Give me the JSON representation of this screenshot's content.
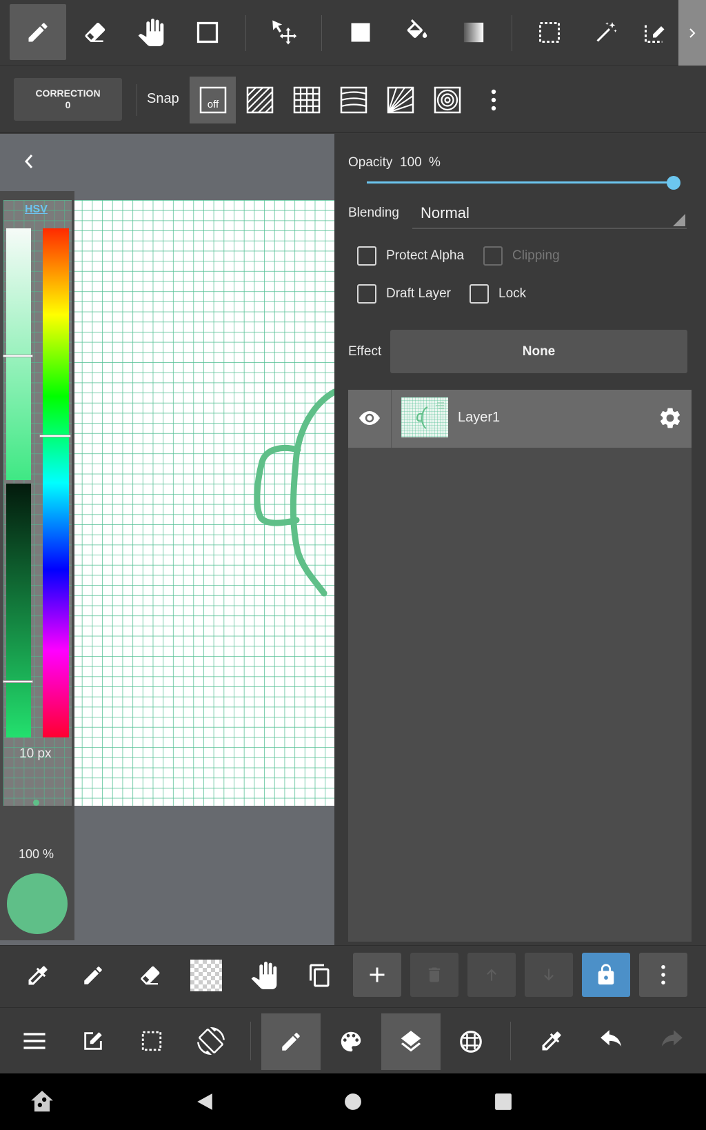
{
  "toolbar": {
    "tools": [
      "pen",
      "eraser",
      "hand",
      "rectangle",
      "move",
      "fill-square",
      "bucket",
      "gradient",
      "select-rect",
      "magic-wand",
      "select-pen"
    ],
    "selected_tool": "pen"
  },
  "sub_toolbar": {
    "correction_label": "CORRECTION",
    "correction_value": "0",
    "snap_label": "Snap",
    "snap_off_label": "off"
  },
  "color_panel": {
    "mode_label": "HSV",
    "brush_size": "10 px",
    "opacity": "100 %",
    "current_color": "#5fbf88"
  },
  "layer_panel": {
    "opacity_label": "Opacity",
    "opacity_value": "100",
    "opacity_unit": "%",
    "opacity_level": 1.0,
    "blending_label": "Blending",
    "blending_value": "Normal",
    "protect_alpha_label": "Protect Alpha",
    "clipping_label": "Clipping",
    "draft_layer_label": "Draft Layer",
    "lock_label": "Lock",
    "effect_label": "Effect",
    "effect_value": "None",
    "layers": [
      {
        "name": "Layer1",
        "visible": true
      }
    ]
  },
  "colors": {
    "accent": "#6cc6ef",
    "lock_button": "#4c90c8",
    "stroke": "#5fbf88"
  }
}
